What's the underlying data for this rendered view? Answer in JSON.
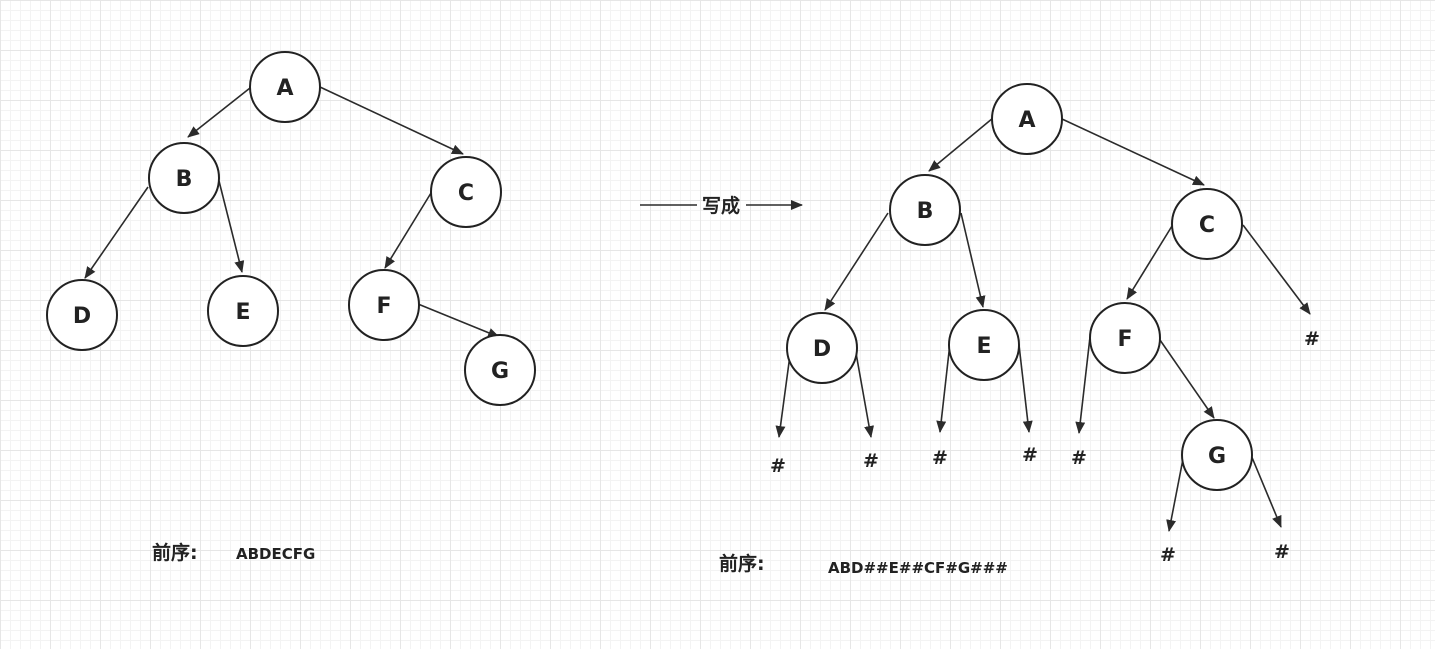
{
  "left_tree": {
    "nodes": [
      "A",
      "B",
      "C",
      "D",
      "E",
      "F",
      "G"
    ],
    "caption_label": "前序:",
    "caption_sequence": "ABDECFG"
  },
  "transform_arrow_label": "写成",
  "right_tree": {
    "nodes": [
      "A",
      "B",
      "C",
      "D",
      "E",
      "F",
      "G"
    ],
    "null_marker": "#",
    "caption_label": "前序:",
    "caption_sequence": "ABD##E##CF#G###"
  }
}
